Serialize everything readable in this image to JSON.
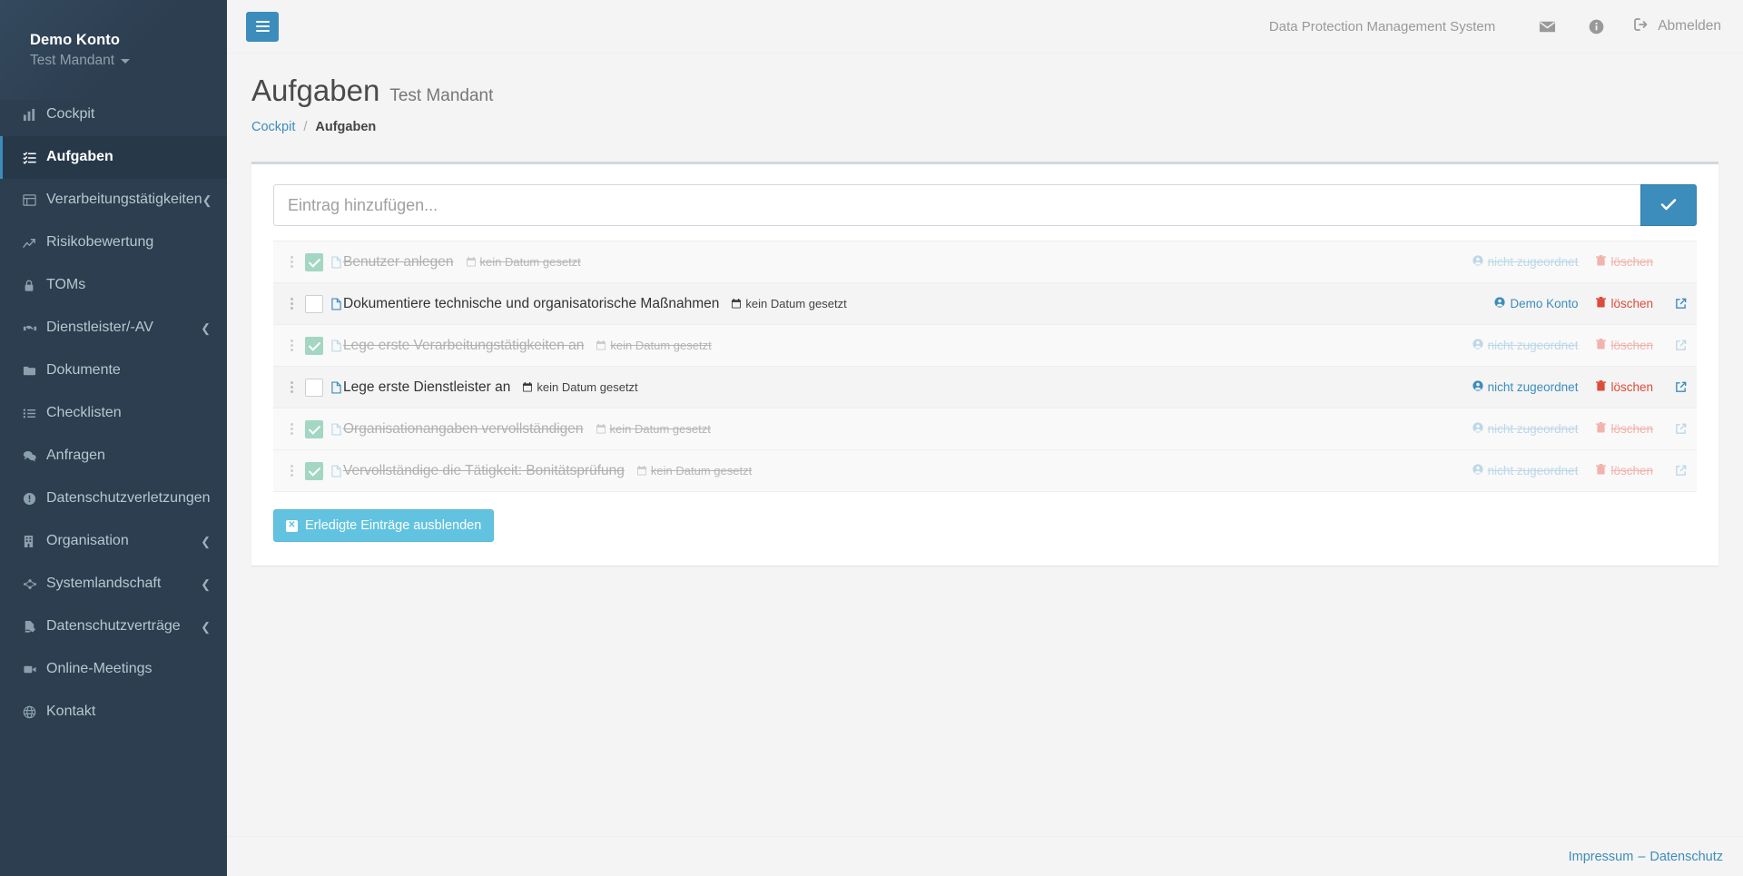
{
  "sidebar": {
    "account": "Demo Konto",
    "mandant": "Test Mandant",
    "items": [
      {
        "label": "Cockpit",
        "icon": "chart-bar-icon",
        "active": false,
        "expandable": false
      },
      {
        "label": "Aufgaben",
        "icon": "task-list-icon",
        "active": true,
        "expandable": false
      },
      {
        "label": "Verarbeitungstätigkeiten",
        "icon": "table-icon",
        "active": false,
        "expandable": true
      },
      {
        "label": "Risikobewertung",
        "icon": "line-chart-icon",
        "active": false,
        "expandable": false
      },
      {
        "label": "TOMs",
        "icon": "lock-icon",
        "active": false,
        "expandable": false
      },
      {
        "label": "Dienstleister/-AV",
        "icon": "handshake-icon",
        "active": false,
        "expandable": true
      },
      {
        "label": "Dokumente",
        "icon": "folder-icon",
        "active": false,
        "expandable": false
      },
      {
        "label": "Checklisten",
        "icon": "list-icon",
        "active": false,
        "expandable": false
      },
      {
        "label": "Anfragen",
        "icon": "comments-icon",
        "active": false,
        "expandable": false
      },
      {
        "label": "Datenschutzverletzungen",
        "icon": "exclamation-circle-icon",
        "active": false,
        "expandable": false
      },
      {
        "label": "Organisation",
        "icon": "building-icon",
        "active": false,
        "expandable": true
      },
      {
        "label": "Systemlandschaft",
        "icon": "network-nodes-icon",
        "active": false,
        "expandable": true
      },
      {
        "label": "Datenschutzverträge",
        "icon": "file-signature-icon",
        "active": false,
        "expandable": true
      },
      {
        "label": "Online-Meetings",
        "icon": "video-camera-icon",
        "active": false,
        "expandable": false
      },
      {
        "label": "Kontakt",
        "icon": "globe-icon",
        "active": false,
        "expandable": false
      }
    ]
  },
  "topbar": {
    "menu_toggle_label": "Menü",
    "system_title": "Data Protection Management System",
    "mail_icon": "envelope-icon",
    "info_icon": "info-circle-icon",
    "logout_icon": "sign-out-icon",
    "logout_label": "Abmelden"
  },
  "page": {
    "title": "Aufgaben",
    "subtitle": "Test Mandant",
    "breadcrumb": [
      {
        "label": "Cockpit",
        "current": false
      },
      {
        "label": "Aufgaben",
        "current": true
      }
    ],
    "breadcrumb_separator": "/"
  },
  "add_entry": {
    "placeholder": "Eintrag hinzufügen...",
    "value": "",
    "submit_icon": "check-icon"
  },
  "todos": [
    {
      "text": "Benutzer anlegen",
      "done": true,
      "due": "kein Datum gesetzt",
      "assignee": "nicht zugeordnet",
      "delete_label": "löschen",
      "has_external_link": false
    },
    {
      "text": "Dokumentiere technische und organisatorische Maßnahmen",
      "done": false,
      "due": "kein Datum gesetzt",
      "assignee": "Demo Konto",
      "delete_label": "löschen",
      "has_external_link": true
    },
    {
      "text": "Lege erste Verarbeitungstätigkeiten an",
      "done": true,
      "due": "kein Datum gesetzt",
      "assignee": "nicht zugeordnet",
      "delete_label": "löschen",
      "has_external_link": true
    },
    {
      "text": "Lege erste Dienstleister an",
      "done": false,
      "due": "kein Datum gesetzt",
      "assignee": "nicht zugeordnet",
      "delete_label": "löschen",
      "has_external_link": true
    },
    {
      "text": "Organisationangaben vervollständigen",
      "done": true,
      "due": "kein Datum gesetzt",
      "assignee": "nicht zugeordnet",
      "delete_label": "löschen",
      "has_external_link": true
    },
    {
      "text": "Vervollständige die Tätigkeit: Bonitätsprüfung",
      "done": true,
      "due": "kein Datum gesetzt",
      "assignee": "nicht zugeordnet",
      "delete_label": "löschen",
      "has_external_link": true
    }
  ],
  "hide_done_button": {
    "label": "Erledigte Einträge ausblenden",
    "icon": "x-square-icon"
  },
  "footer": {
    "impressum": "Impressum",
    "dash": "–",
    "datenschutz": "Datenschutz"
  },
  "colors": {
    "sidebar_bg": "#2c3e50",
    "sidebar_active_bg": "#273849",
    "accent_blue": "#3c8dbc",
    "checkbox_done": "#a3d6c3",
    "danger_red": "#dd4b39",
    "hide_btn_blue": "#62c3e0"
  }
}
